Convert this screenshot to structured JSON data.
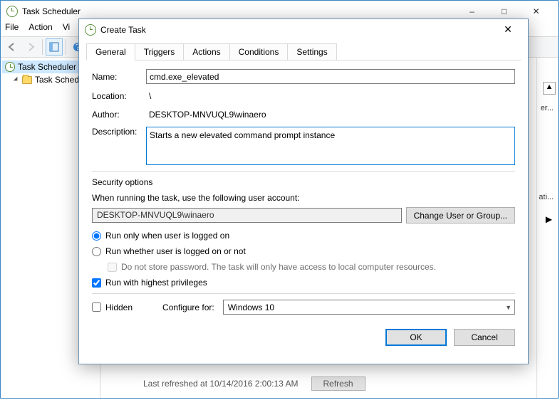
{
  "main": {
    "title": "Task Scheduler",
    "menu": {
      "file": "File",
      "action": "Action",
      "view": "Vi"
    },
    "tree": {
      "root": "Task Scheduler",
      "child": "Task Sched"
    },
    "status": {
      "text": "Last refreshed at 10/14/2016 2:00:13 AM",
      "refresh": "Refresh"
    },
    "side": {
      "er": "er...",
      "ati": "ati..."
    }
  },
  "dialog": {
    "title": "Create Task",
    "tabs": {
      "general": "General",
      "triggers": "Triggers",
      "actions": "Actions",
      "conditions": "Conditions",
      "settings": "Settings"
    },
    "labels": {
      "name": "Name:",
      "location": "Location:",
      "author": "Author:",
      "description": "Description:",
      "security": "Security options",
      "when_running": "When running the task, use the following user account:",
      "change_user": "Change User or Group...",
      "radio_logged_on": "Run only when user is logged on",
      "radio_whether": "Run whether user is logged on or not",
      "no_store": "Do not store password.  The task will only have access to local computer resources.",
      "highest": "Run with highest privileges",
      "hidden": "Hidden",
      "configure_for": "Configure for:"
    },
    "values": {
      "name": "cmd.exe_elevated",
      "location": "\\",
      "author": "DESKTOP-MNVUQL9\\winaero",
      "description": "Starts a new elevated command prompt instance",
      "account": "DESKTOP-MNVUQL9\\winaero",
      "configure_for": "Windows 10"
    },
    "buttons": {
      "ok": "OK",
      "cancel": "Cancel"
    }
  }
}
